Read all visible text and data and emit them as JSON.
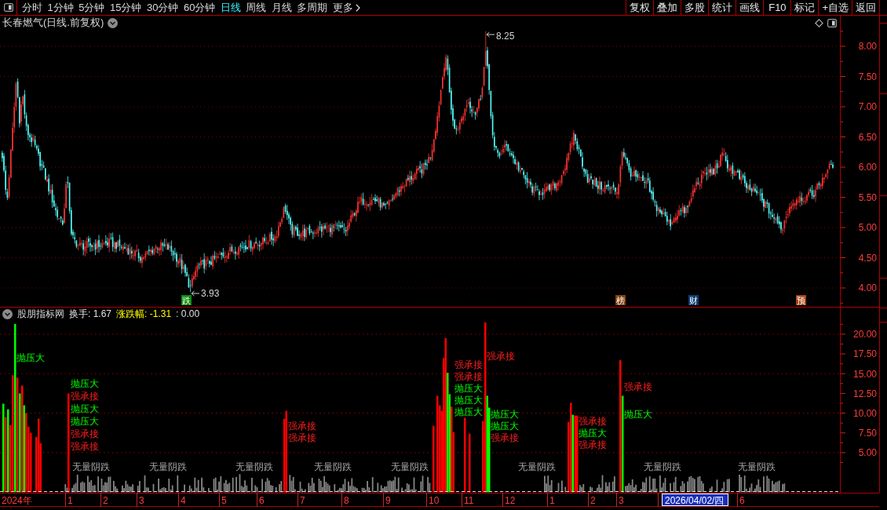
{
  "toolbar": {
    "periods": [
      {
        "label": "分时",
        "selected": false
      },
      {
        "label": "1分钟",
        "selected": false
      },
      {
        "label": "5分钟",
        "selected": false
      },
      {
        "label": "15分钟",
        "selected": false
      },
      {
        "label": "30分钟",
        "selected": false
      },
      {
        "label": "60分钟",
        "selected": false
      },
      {
        "label": "日线",
        "selected": true
      },
      {
        "label": "周线",
        "selected": false
      },
      {
        "label": "月线",
        "selected": false
      },
      {
        "label": "多周期",
        "selected": false
      }
    ],
    "more": "更多",
    "buttons": [
      "复权",
      "叠加",
      "多股",
      "统计",
      "画线",
      "F10",
      "标记",
      "+自选",
      "返回"
    ]
  },
  "price_chart": {
    "title": "长春燃气(日线.前复权)",
    "high_label": "8.25",
    "low_label": "3.93",
    "events": [
      {
        "text": "跌",
        "color": "#0a8a0a"
      },
      {
        "text": "榜",
        "color": "#84420c"
      },
      {
        "text": "财",
        "color": "#0c3c70"
      },
      {
        "text": "预",
        "color": "#a8420e"
      }
    ],
    "axis_ticks": [
      "8.00",
      "7.50",
      "7.00",
      "6.50",
      "6.00",
      "5.50",
      "5.00",
      "4.50",
      "4.00"
    ]
  },
  "indicator": {
    "name": "股朋指标网",
    "readings": [
      {
        "text": "换手: 1.67",
        "color": "#e0e0e0"
      },
      {
        "text": "涨跌幅: -1.31",
        "color": "#ffff00"
      },
      {
        "text": ": 0.00",
        "color": "#e0e0e0"
      }
    ],
    "axis_ticks": [
      "20.00",
      "17.50",
      "15.00",
      "12.50",
      "10.00",
      "7.50",
      "5.00"
    ],
    "signals": [
      {
        "text": "抛压大",
        "kind": "pressure"
      },
      {
        "text": "抛压大",
        "kind": "pressure"
      },
      {
        "text": "强承接",
        "kind": "support"
      },
      {
        "text": "抛压大",
        "kind": "pressure"
      },
      {
        "text": "抛压大",
        "kind": "pressure"
      },
      {
        "text": "强承接",
        "kind": "support"
      },
      {
        "text": "强承接",
        "kind": "support"
      },
      {
        "text": "无量阴跌",
        "kind": "drop"
      },
      {
        "text": "无量阴跌",
        "kind": "drop"
      },
      {
        "text": "无量阴跌",
        "kind": "drop"
      },
      {
        "text": "强承接",
        "kind": "support"
      },
      {
        "text": "强承接",
        "kind": "support"
      },
      {
        "text": "无量阴跌",
        "kind": "drop"
      },
      {
        "text": "无量阴跌",
        "kind": "drop"
      },
      {
        "text": "强承接",
        "kind": "support"
      },
      {
        "text": "强承接",
        "kind": "support"
      },
      {
        "text": "抛压大",
        "kind": "pressure"
      },
      {
        "text": "抛压大",
        "kind": "pressure"
      },
      {
        "text": "抛压大",
        "kind": "pressure"
      },
      {
        "text": "强承接",
        "kind": "support"
      },
      {
        "text": "抛压大",
        "kind": "pressure"
      },
      {
        "text": "抛压大",
        "kind": "pressure"
      },
      {
        "text": "强承接",
        "kind": "support"
      },
      {
        "text": "无量阴跌",
        "kind": "drop"
      },
      {
        "text": "强承接",
        "kind": "support"
      },
      {
        "text": "抛压大",
        "kind": "pressure"
      },
      {
        "text": "强承接",
        "kind": "support"
      },
      {
        "text": "强承接",
        "kind": "support"
      },
      {
        "text": "抛压大",
        "kind": "pressure"
      },
      {
        "text": "无量阴跌",
        "kind": "drop"
      },
      {
        "text": "无量阴跌",
        "kind": "drop"
      }
    ]
  },
  "date_axis": {
    "labels": [
      "2024年",
      "1",
      "2",
      "3",
      "4",
      "5",
      "6",
      "7",
      "8",
      "9",
      "10",
      "11",
      "12",
      "1",
      "2",
      "3"
    ],
    "cursor_date": "2026/04/02/四",
    "after_cursor": [
      "6"
    ]
  }
}
